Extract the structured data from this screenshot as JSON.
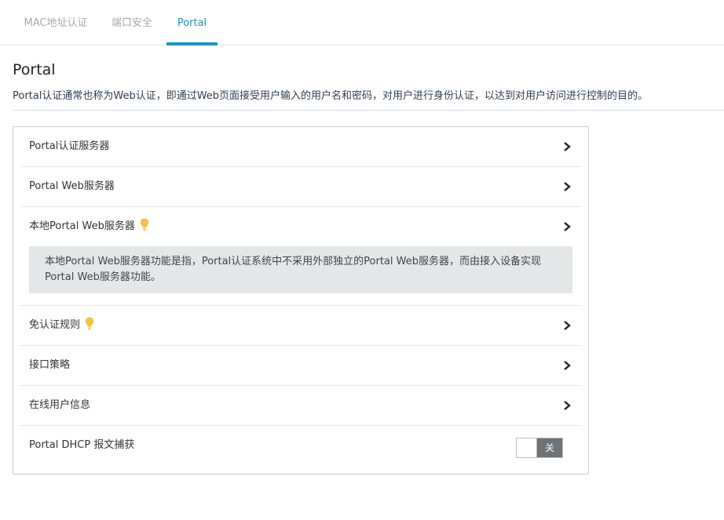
{
  "tabs": [
    {
      "label": "MAC地址认证",
      "active": false
    },
    {
      "label": "端口安全",
      "active": false
    },
    {
      "label": "Portal",
      "active": true
    }
  ],
  "page": {
    "title": "Portal",
    "description": "Portal认证通常也称为Web认证，即通过Web页面接受用户输入的用户名和密码，对用户进行身份认证，以达到对用户访问进行控制的目的。"
  },
  "items": [
    {
      "label": "Portal认证服务器",
      "icon": "chevron-right-icon"
    },
    {
      "label": "Portal Web服务器",
      "icon": "chevron-right-icon"
    },
    {
      "label": "本地Portal Web服务器",
      "icon": "chevron-right-icon",
      "hint_icon": "lightbulb-icon",
      "info": "本地Portal Web服务器功能是指，Portal认证系统中不采用外部独立的Portal Web服务器，而由接入设备实现Portal Web服务器功能。"
    },
    {
      "label": "免认证规则",
      "icon": "chevron-right-icon",
      "hint_icon": "lightbulb-icon"
    },
    {
      "label": "接口策略",
      "icon": "chevron-right-icon"
    },
    {
      "label": "在线用户信息",
      "icon": "chevron-right-icon"
    }
  ],
  "dhcp_toggle": {
    "label": "Portal DHCP 报文捕获",
    "state_label": "关",
    "on": false
  },
  "colors": {
    "accent": "#1a94c8",
    "bulb": "#f5c242",
    "info_bg": "#e4e7e8",
    "toggle_off": "#6e7377"
  }
}
